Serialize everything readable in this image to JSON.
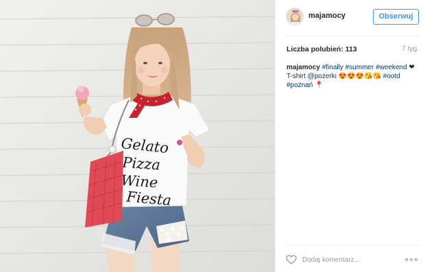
{
  "post": {
    "username": "majamocy",
    "follow_label": "Obserwuj",
    "likes_label": "Liczba polubień: 113",
    "time_ago": "7 tyg.",
    "caption": {
      "line1": {
        "user": "majamocy",
        "tags": [
          "#finally",
          "#summer",
          "#weekend"
        ],
        "suffix": "❤"
      },
      "line2": {
        "prefix": "T-shirt",
        "mention": "@pozerki",
        "emojis": "😍😍😍😘😘",
        "tag": "#ootd"
      },
      "line3": {
        "tag": "#poznań",
        "emoji": "📍"
      }
    },
    "comment_placeholder": "Dodaj komentarz...",
    "tshirt_text": [
      "Gelato",
      "Pizza",
      "Wine",
      "Fiesta"
    ]
  },
  "colors": {
    "accent": "#3897f0",
    "text": "#262626",
    "muted": "#999999",
    "hashtag": "#003569",
    "divider": "#efefef"
  },
  "icons": {
    "like": "heart-outline-icon",
    "more": "more-options-icon"
  }
}
